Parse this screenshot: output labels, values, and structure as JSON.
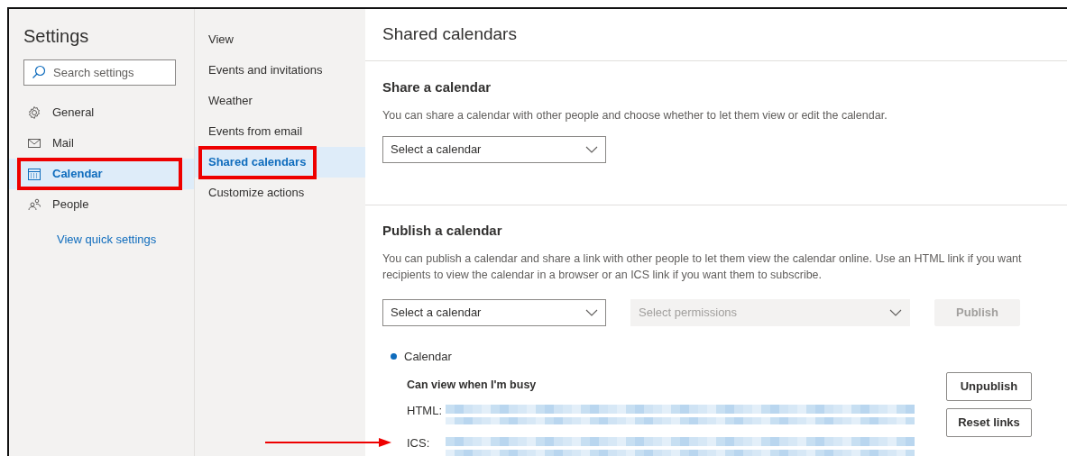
{
  "settings_nav": {
    "title": "Settings",
    "search": {
      "placeholder": "Search settings"
    },
    "items": [
      {
        "label": "General",
        "selected": false,
        "annotated": false
      },
      {
        "label": "Mail",
        "selected": false,
        "annotated": false
      },
      {
        "label": "Calendar",
        "selected": true,
        "annotated": true
      },
      {
        "label": "People",
        "selected": false,
        "annotated": false
      }
    ],
    "link": "View quick settings"
  },
  "calendar_nav": {
    "items": [
      {
        "label": "View",
        "selected": false,
        "annotated": false
      },
      {
        "label": "Events and invitations",
        "selected": false,
        "annotated": false
      },
      {
        "label": "Weather",
        "selected": false,
        "annotated": false
      },
      {
        "label": "Events from email",
        "selected": false,
        "annotated": false
      },
      {
        "label": "Shared calendars",
        "selected": true,
        "annotated": true
      },
      {
        "label": "Customize actions",
        "selected": false,
        "annotated": false
      }
    ]
  },
  "panel": {
    "title": "Shared calendars",
    "share": {
      "heading": "Share a calendar",
      "description": "You can share a calendar with other people and choose whether to let them view or edit the calendar.",
      "select": {
        "placeholder": "Select a calendar"
      }
    },
    "publish": {
      "heading": "Publish a calendar",
      "description": "You can publish a calendar and share a link with other people to let them view the calendar online. Use an HTML link if you want recipients to view the calendar in a browser or an ICS link if you want them to subscribe.",
      "calendar_select": {
        "placeholder": "Select a calendar"
      },
      "permissions_select": {
        "placeholder": "Select permissions",
        "disabled": true
      },
      "publish_button": {
        "label": "Publish",
        "disabled": true
      },
      "published": [
        {
          "calendar": "Calendar",
          "permission": "Can view when I'm busy",
          "links": [
            {
              "label": "HTML:",
              "arrow": false
            },
            {
              "label": "ICS:",
              "arrow": true
            }
          ],
          "buttons": [
            "Unpublish",
            "Reset links"
          ]
        }
      ]
    }
  }
}
